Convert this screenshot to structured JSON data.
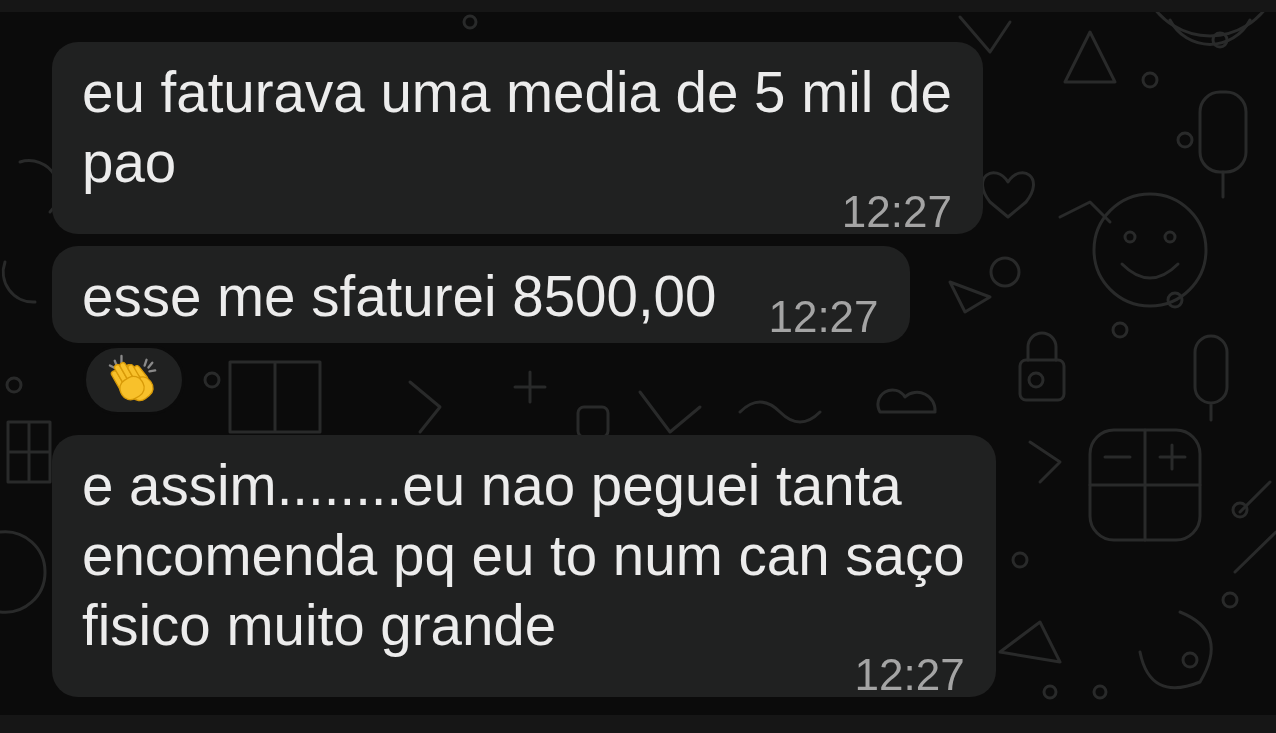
{
  "messages": [
    {
      "lines": [
        "eu faturava uma media de 5 mil de",
        "pao"
      ],
      "time": "12:27",
      "reacted": false
    },
    {
      "lines": [
        "esse me sfaturei 8500,00"
      ],
      "time": "12:27",
      "reacted": true
    },
    {
      "lines": [
        "e assim........eu nao peguei tanta",
        "encomenda pq eu to num can saço",
        "fisico muito grande"
      ],
      "time": "12:27",
      "reacted": false
    }
  ]
}
